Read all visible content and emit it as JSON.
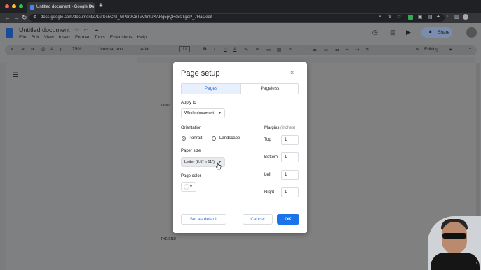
{
  "browser": {
    "tab_title": "Untitled document - Google Do",
    "tab_close": "×",
    "new_tab": "+",
    "url": "docs.google.com/document/d/1ufSe5CfU_GPer9C8TvVfmlUXARg5pQRc50TgdP_7Has/edit",
    "nav": {
      "back": "←",
      "forward": "→",
      "reload": "↻"
    },
    "traffic_colors": [
      "#ff5f57",
      "#febc2e",
      "#28c840"
    ]
  },
  "docs": {
    "title": "Untitled document",
    "menu": [
      "File",
      "Edit",
      "View",
      "Insert",
      "Format",
      "Tools",
      "Extensions",
      "Help"
    ],
    "share_label": "Share",
    "toolbar": {
      "zoom": "75%",
      "style": "Normal text",
      "font": "Arial",
      "font_size": "11",
      "mode": "Editing"
    },
    "body": {
      "task_text": "Task2",
      "end_text": "THE END"
    }
  },
  "dialog": {
    "title": "Page setup",
    "close": "×",
    "tabs": [
      "Pages",
      "Pageless"
    ],
    "apply_to_label": "Apply to",
    "apply_to_value": "Whole document",
    "orientation_label": "Orientation",
    "orientation_options": [
      "Portrait",
      "Landscape"
    ],
    "orientation_selected": "Portrait",
    "paper_size_label": "Paper size",
    "paper_size_value": "Letter (8.5\" x 11\")",
    "page_color_label": "Page color",
    "margins_label": "Margins",
    "margins_unit": "(inches)",
    "margins": [
      {
        "label": "Top",
        "value": "1"
      },
      {
        "label": "Bottom",
        "value": "1"
      },
      {
        "label": "Left",
        "value": "1"
      },
      {
        "label": "Right",
        "value": "1"
      }
    ],
    "buttons": {
      "set_default": "Set as default",
      "cancel": "Cancel",
      "ok": "OK"
    }
  },
  "colors": {
    "accent": "#1a73e8",
    "dim": "#7f8082",
    "tab_active_bg": "#e8f0fe"
  }
}
